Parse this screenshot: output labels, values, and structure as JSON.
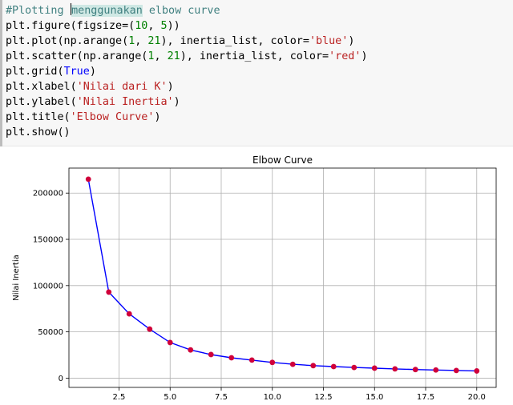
{
  "code_cell": {
    "lines": [
      [
        {
          "t": "comment",
          "v": "#Plotting "
        },
        {
          "t": "hl",
          "v": "menggunakan"
        },
        {
          "t": "comment",
          "v": " elbow curve"
        }
      ],
      [
        {
          "t": "p",
          "v": "plt.figure(figsize=("
        },
        {
          "t": "num",
          "v": "10"
        },
        {
          "t": "p",
          "v": ", "
        },
        {
          "t": "num",
          "v": "5"
        },
        {
          "t": "p",
          "v": "))"
        }
      ],
      [
        {
          "t": "p",
          "v": "plt.plot(np.arange("
        },
        {
          "t": "num",
          "v": "1"
        },
        {
          "t": "p",
          "v": ", "
        },
        {
          "t": "num",
          "v": "21"
        },
        {
          "t": "p",
          "v": "), inertia_list, color="
        },
        {
          "t": "str",
          "v": "'blue'"
        },
        {
          "t": "p",
          "v": ")"
        }
      ],
      [
        {
          "t": "p",
          "v": "plt.scatter(np.arange("
        },
        {
          "t": "num",
          "v": "1"
        },
        {
          "t": "p",
          "v": ", "
        },
        {
          "t": "num",
          "v": "21"
        },
        {
          "t": "p",
          "v": "), inertia_list, color="
        },
        {
          "t": "str",
          "v": "'red'"
        },
        {
          "t": "p",
          "v": ")"
        }
      ],
      [
        {
          "t": "p",
          "v": "plt.grid("
        },
        {
          "t": "kw",
          "v": "True"
        },
        {
          "t": "p",
          "v": ")"
        }
      ],
      [
        {
          "t": "p",
          "v": "plt.xlabel("
        },
        {
          "t": "str",
          "v": "'Nilai dari K'"
        },
        {
          "t": "p",
          "v": ")"
        }
      ],
      [
        {
          "t": "p",
          "v": "plt.ylabel("
        },
        {
          "t": "str",
          "v": "'Nilai Inertia'"
        },
        {
          "t": "p",
          "v": ")"
        }
      ],
      [
        {
          "t": "p",
          "v": "plt.title("
        },
        {
          "t": "str",
          "v": "'Elbow Curve'"
        },
        {
          "t": "p",
          "v": ")"
        }
      ],
      [
        {
          "t": "p",
          "v": "plt.show()"
        }
      ]
    ]
  },
  "colors": {
    "line": "#0000ff",
    "marker": "#d0003a",
    "grid": "#b0b0b0",
    "cell_background": "#f7f7f7"
  },
  "chart_data": {
    "type": "line",
    "title": "Elbow Curve",
    "xlabel": "Nilai dari K",
    "ylabel": "Nilai Inertia",
    "grid": true,
    "xlim": [
      0.05,
      20.95
    ],
    "ylim": [
      -10000,
      227000
    ],
    "xticks": [
      2.5,
      5.0,
      7.5,
      10.0,
      12.5,
      15.0,
      17.5,
      20.0
    ],
    "xtick_labels": [
      "2.5",
      "5.0",
      "7.5",
      "10.0",
      "12.5",
      "15.0",
      "17.5",
      "20.0"
    ],
    "yticks": [
      0,
      50000,
      100000,
      150000,
      200000
    ],
    "ytick_labels": [
      "0",
      "50000",
      "100000",
      "150000",
      "200000"
    ],
    "series": [
      {
        "x": [
          1,
          2,
          3,
          4,
          5,
          6,
          7,
          8,
          9,
          10,
          11,
          12,
          13,
          14,
          15,
          16,
          17,
          18,
          19,
          20
        ],
        "y": [
          215000,
          93000,
          69500,
          53000,
          38500,
          30500,
          25500,
          22000,
          19500,
          17000,
          15000,
          13500,
          12500,
          11500,
          10800,
          10000,
          9300,
          8800,
          8300,
          7800
        ]
      }
    ]
  }
}
